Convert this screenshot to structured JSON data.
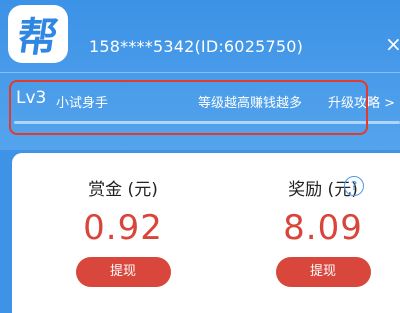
{
  "header": {
    "logo_text": "帮",
    "phone_id": "158****5342(ID:6025750)",
    "close_icon": "×"
  },
  "level": {
    "code": "Lv3",
    "name": "小试身手",
    "hint": "等级越高赚钱越多",
    "upgrade_link": "升级攻略 >",
    "progress": 0.0
  },
  "rewards": {
    "bounty": {
      "title": "赏金 (元)",
      "value": "0.92",
      "button": "提现"
    },
    "award": {
      "title": "奖励 (元)",
      "value": "8.09",
      "button": "提现",
      "help_icon": "?"
    }
  },
  "colors": {
    "brand_blue": "#3e93e6",
    "value_red": "#d9453a",
    "highlight_red": "#e33a2e"
  }
}
